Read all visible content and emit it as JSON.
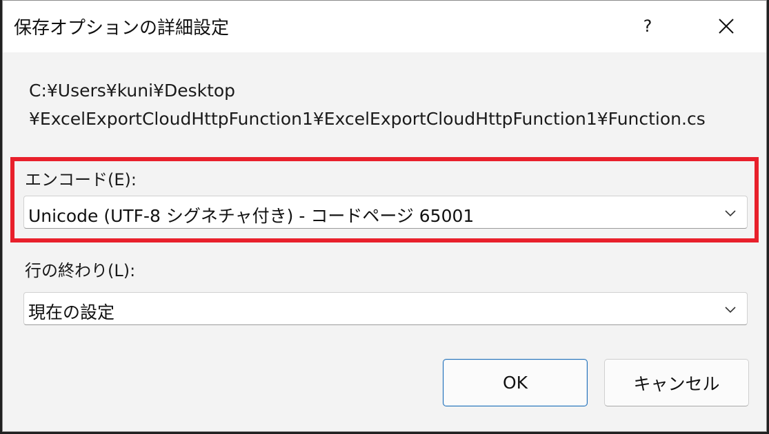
{
  "dialog": {
    "title": "保存オプションの詳細設定",
    "help_label": "?",
    "close_icon": "close-icon"
  },
  "file_path": {
    "line1": "C:¥Users¥kuni¥Desktop",
    "line2": "¥ExcelExportCloudHttpFunction1¥ExcelExportCloudHttpFunction1¥Function.cs"
  },
  "encoding": {
    "label": "エンコード(E):",
    "selected_value": "Unicode (UTF-8 シグネチャ付き) - コードページ 65001",
    "highlight_color": "#e8202b"
  },
  "line_endings": {
    "label": "行の終わり(L):",
    "selected_value": "現在の設定"
  },
  "buttons": {
    "ok_label": "OK",
    "cancel_label": "キャンセル"
  },
  "colors": {
    "accent_border": "#1f6fb8",
    "dialog_background": "#f3f3f3"
  }
}
